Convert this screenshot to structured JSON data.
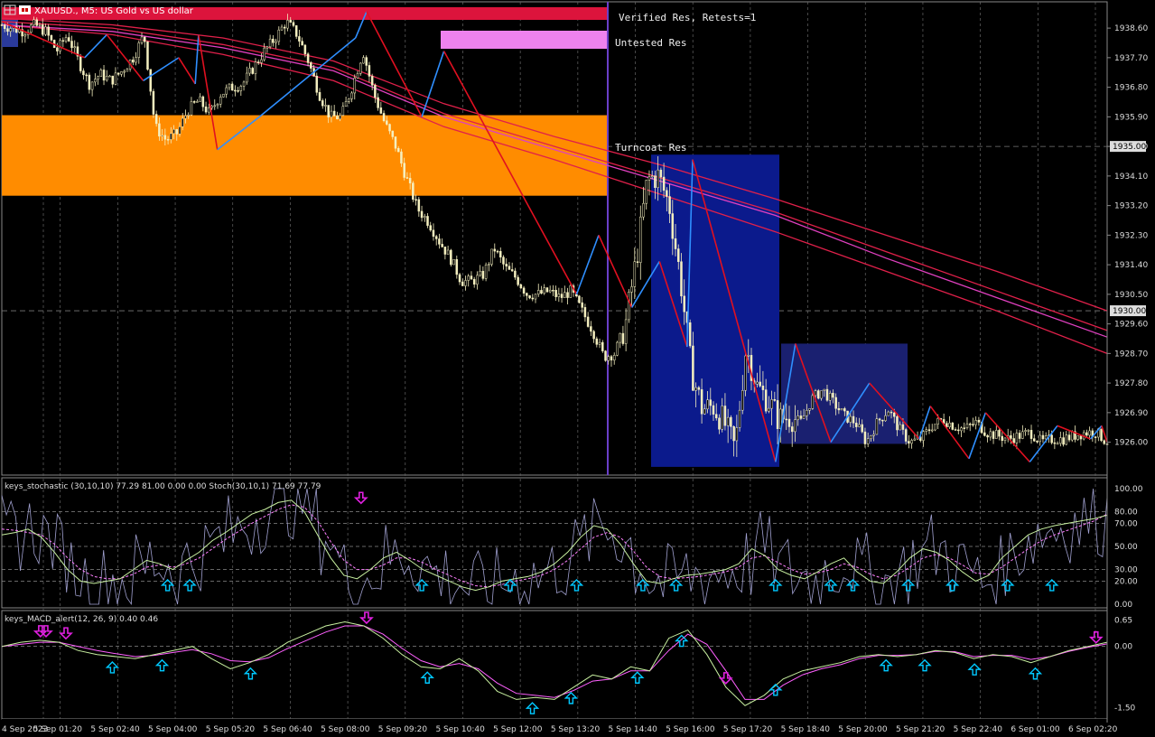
{
  "window": {
    "symbol_title": "XAUUSD., M5:  US Gold vs US dollar"
  },
  "zones": [
    {
      "label": "Verified Res, Retests=1"
    },
    {
      "label": "Untested Res"
    },
    {
      "label": "Turncoat Res"
    }
  ],
  "colors": {
    "background": "#000000",
    "candle": "#f5f0c0",
    "zigzag_up": "#2f8fff",
    "zigzag_down": "#e01020",
    "ma": "#e0204a",
    "ma_magenta": "#e040c0",
    "zone_verified": "#dc143c",
    "zone_untested": "#ee82ee",
    "zone_turncoat": "#ff8c00",
    "box_blue": "#0b1a8c",
    "box_blue2": "#1a2070",
    "session_line": "#6a3fc8",
    "stoch_main": "#c8f0a0",
    "stoch_signal": "#ff80ff",
    "stoch_raw": "#a0a0d0",
    "macd_main": "#c8f0a0",
    "macd_signal": "#ff60ff",
    "arrow_up": "#00c8ff",
    "arrow_down": "#e020e0"
  },
  "chart_data": [
    {
      "type": "candlestick",
      "name": "XAUUSD., M5",
      "ylim": [
        1925.0,
        1939.4
      ],
      "y_ticks": [
        "1938.60",
        "1937.70",
        "1936.80",
        "1935.90",
        "1935.00",
        "1934.10",
        "1933.20",
        "1932.30",
        "1931.40",
        "1930.50",
        "1929.60",
        "1928.70",
        "1927.80",
        "1926.90",
        "1926.00"
      ],
      "price_markers": [
        "1935.00",
        "1930.00"
      ],
      "x_ticks": [
        "4 Sep 2023",
        "5 Sep 01:20",
        "5 Sep 02:40",
        "5 Sep 04:00",
        "5 Sep 05:20",
        "5 Sep 06:40",
        "5 Sep 08:00",
        "5 Sep 09:20",
        "5 Sep 10:40",
        "5 Sep 12:00",
        "5 Sep 13:20",
        "5 Sep 14:40",
        "5 Sep 16:00",
        "5 Sep 17:20",
        "5 Sep 18:40",
        "5 Sep 20:00",
        "5 Sep 21:20",
        "5 Sep 22:40",
        "6 Sep 01:00",
        "6 Sep 02:20"
      ],
      "close_path": [
        1938.7,
        1938.6,
        1938.5,
        1938.7,
        1938.5,
        1937.9,
        1938.4,
        1937.6,
        1936.9,
        1937.2,
        1937.0,
        1937.3,
        1937.7,
        1938.4,
        1935.6,
        1935.2,
        1935.4,
        1936.1,
        1936.4,
        1936.0,
        1936.6,
        1936.8,
        1936.9,
        1937.4,
        1937.9,
        1938.3,
        1938.8,
        1938.4,
        1937.6,
        1936.6,
        1935.9,
        1935.9,
        1936.8,
        1937.9,
        1936.6,
        1935.7,
        1935.0,
        1934.0,
        1933.1,
        1932.7,
        1932.1,
        1931.6,
        1930.9,
        1930.9,
        1931.1,
        1931.9,
        1931.3,
        1931.0,
        1930.5,
        1930.5,
        1930.6,
        1930.4,
        1930.6,
        1930.0,
        1929.4,
        1928.6,
        1928.7,
        1929.6,
        1931.6,
        1934.0,
        1934.1,
        1933.2,
        1931.0,
        1928.2,
        1927.0,
        1927.1,
        1926.6,
        1925.8,
        1928.9,
        1927.7,
        1927.3,
        1926.7,
        1926.8,
        1926.6,
        1927.3,
        1927.6,
        1927.2,
        1926.8,
        1926.6,
        1926.0,
        1926.6,
        1927.0,
        1926.4,
        1926.0,
        1926.1,
        1926.5,
        1926.7,
        1926.5,
        1926.4,
        1926.6,
        1926.3,
        1926.2,
        1926.1,
        1926.2,
        1926.3,
        1926.0,
        1926.1,
        1926.1,
        1926.2,
        1926.3,
        1926.3,
        1926.0
      ],
      "zigzag": [
        {
          "x": 0.0,
          "y": 1938.8
        },
        {
          "x": 0.075,
          "y": 1937.7
        },
        {
          "x": 0.095,
          "y": 1938.4
        },
        {
          "x": 0.128,
          "y": 1937.0
        },
        {
          "x": 0.16,
          "y": 1937.7
        },
        {
          "x": 0.175,
          "y": 1936.9
        },
        {
          "x": 0.178,
          "y": 1938.4
        },
        {
          "x": 0.195,
          "y": 1934.9
        },
        {
          "x": 0.233,
          "y": 1935.9
        },
        {
          "x": 0.32,
          "y": 1938.3
        },
        {
          "x": 0.33,
          "y": 1939.1
        },
        {
          "x": 0.38,
          "y": 1935.9
        },
        {
          "x": 0.4,
          "y": 1937.9
        },
        {
          "x": 0.52,
          "y": 1930.5
        },
        {
          "x": 0.54,
          "y": 1932.3
        },
        {
          "x": 0.57,
          "y": 1930.1
        },
        {
          "x": 0.595,
          "y": 1931.5
        },
        {
          "x": 0.62,
          "y": 1928.9
        },
        {
          "x": 0.625,
          "y": 1934.6
        },
        {
          "x": 0.7,
          "y": 1925.4
        },
        {
          "x": 0.718,
          "y": 1929.0
        },
        {
          "x": 0.75,
          "y": 1926.0
        },
        {
          "x": 0.785,
          "y": 1927.8
        },
        {
          "x": 0.83,
          "y": 1926.1
        },
        {
          "x": 0.84,
          "y": 1927.1
        },
        {
          "x": 0.875,
          "y": 1925.5
        },
        {
          "x": 0.89,
          "y": 1926.9
        },
        {
          "x": 0.93,
          "y": 1925.4
        },
        {
          "x": 0.955,
          "y": 1926.5
        },
        {
          "x": 0.985,
          "y": 1926.1
        },
        {
          "x": 0.995,
          "y": 1926.5
        },
        {
          "x": 1.0,
          "y": 1926.0
        }
      ],
      "moving_averages": [
        {
          "color": "ma",
          "values": [
            1938.9,
            1938.7,
            1938.3,
            1937.6,
            1936.3,
            1935.3,
            1934.4,
            1933.4,
            1932.3,
            1931.2,
            1930.0
          ]
        },
        {
          "color": "ma",
          "values": [
            1938.8,
            1938.6,
            1938.1,
            1937.4,
            1936.0,
            1935.0,
            1934.0,
            1933.0,
            1931.8,
            1930.6,
            1929.4
          ]
        },
        {
          "color": "ma",
          "values": [
            1938.7,
            1938.4,
            1937.8,
            1937.0,
            1935.6,
            1934.6,
            1933.5,
            1932.4,
            1931.2,
            1930.0,
            1928.7
          ]
        },
        {
          "color": "ma_magenta",
          "values": [
            1938.7,
            1938.5,
            1938.0,
            1937.3,
            1935.9,
            1934.9,
            1933.9,
            1932.9,
            1931.6,
            1930.4,
            1929.2
          ]
        }
      ]
    },
    {
      "type": "line",
      "name": "stochastic",
      "header": "keys_stochastic (30,10,10) 77.29 81.00 0.00 0.00 Stoch(30,10,1) 71.69 77.79",
      "ylim": [
        0,
        100
      ],
      "y_ticks": [
        "100.00",
        "80.00",
        "70.00",
        "50.00",
        "30.00",
        "20.00",
        "0.00"
      ],
      "levels": [
        80,
        70,
        50,
        30,
        20
      ],
      "main": [
        60,
        62,
        65,
        58,
        45,
        30,
        20,
        18,
        20,
        22,
        30,
        38,
        35,
        30,
        38,
        45,
        55,
        62,
        70,
        78,
        82,
        88,
        90,
        80,
        60,
        40,
        25,
        22,
        30,
        40,
        45,
        38,
        30,
        25,
        20,
        15,
        12,
        15,
        20,
        22,
        24,
        28,
        35,
        45,
        58,
        68,
        65,
        52,
        35,
        20,
        18,
        22,
        25,
        26,
        28,
        30,
        35,
        48,
        42,
        30,
        25,
        22,
        28,
        35,
        40,
        28,
        20,
        18,
        28,
        40,
        48,
        45,
        38,
        28,
        20,
        25,
        40,
        50,
        60,
        65,
        68,
        70,
        72,
        74,
        77
      ],
      "signal": [
        65,
        64,
        62,
        60,
        52,
        40,
        30,
        24,
        22,
        22,
        26,
        32,
        34,
        32,
        35,
        40,
        48,
        56,
        63,
        70,
        76,
        82,
        86,
        84,
        72,
        54,
        38,
        30,
        30,
        34,
        40,
        40,
        36,
        30,
        25,
        20,
        16,
        15,
        17,
        20,
        22,
        25,
        30,
        38,
        48,
        58,
        62,
        58,
        46,
        32,
        24,
        22,
        23,
        24,
        26,
        28,
        32,
        40,
        42,
        36,
        30,
        26,
        27,
        30,
        35,
        32,
        26,
        22,
        25,
        32,
        40,
        43,
        40,
        34,
        27,
        26,
        32,
        40,
        48,
        55,
        60,
        64,
        68,
        72,
        78
      ],
      "arrows_up": [
        0.15,
        0.17,
        0.38,
        0.46,
        0.52,
        0.58,
        0.61,
        0.7,
        0.75,
        0.77,
        0.82,
        0.86,
        0.91,
        0.95
      ],
      "arrows_down": [
        0.325
      ]
    },
    {
      "type": "line",
      "name": "macd",
      "header": "keys_MACD_alert(12, 26, 9) 0.40 0.46",
      "ylim": [
        -1.6,
        0.7
      ],
      "y_ticks": [
        "0.65",
        "0.00",
        "-1.50"
      ],
      "main": [
        0.0,
        0.1,
        0.15,
        0.1,
        -0.1,
        -0.2,
        -0.25,
        -0.3,
        -0.2,
        -0.1,
        0.0,
        -0.3,
        -0.55,
        -0.4,
        -0.2,
        0.1,
        0.3,
        0.5,
        0.6,
        0.5,
        0.2,
        -0.2,
        -0.5,
        -0.55,
        -0.3,
        -0.6,
        -1.1,
        -1.3,
        -1.25,
        -1.3,
        -1.0,
        -0.7,
        -0.8,
        -0.5,
        -0.6,
        0.2,
        0.4,
        -0.2,
        -1.0,
        -1.45,
        -1.2,
        -0.8,
        -0.6,
        -0.5,
        -0.4,
        -0.25,
        -0.2,
        -0.25,
        -0.2,
        -0.1,
        -0.15,
        -0.3,
        -0.2,
        -0.25,
        -0.4,
        -0.25,
        -0.1,
        0.0,
        0.1
      ],
      "signal": [
        0.0,
        0.05,
        0.1,
        0.1,
        0.0,
        -0.1,
        -0.18,
        -0.25,
        -0.22,
        -0.15,
        -0.08,
        -0.18,
        -0.35,
        -0.38,
        -0.28,
        -0.05,
        0.15,
        0.35,
        0.5,
        0.5,
        0.3,
        -0.05,
        -0.35,
        -0.5,
        -0.42,
        -0.55,
        -0.9,
        -1.15,
        -1.2,
        -1.25,
        -1.08,
        -0.85,
        -0.8,
        -0.6,
        -0.6,
        -0.1,
        0.3,
        0.05,
        -0.6,
        -1.3,
        -1.3,
        -0.95,
        -0.7,
        -0.55,
        -0.45,
        -0.3,
        -0.22,
        -0.22,
        -0.2,
        -0.12,
        -0.13,
        -0.25,
        -0.22,
        -0.22,
        -0.32,
        -0.25,
        -0.12,
        -0.02,
        0.06
      ],
      "arrows_up": [
        0.1,
        0.145,
        0.225,
        0.385,
        0.48,
        0.515,
        0.575,
        0.615,
        0.7,
        0.8,
        0.835,
        0.88,
        0.935
      ],
      "arrows_down": [
        0.035,
        0.04,
        0.058,
        0.33,
        0.655,
        0.99
      ]
    }
  ]
}
